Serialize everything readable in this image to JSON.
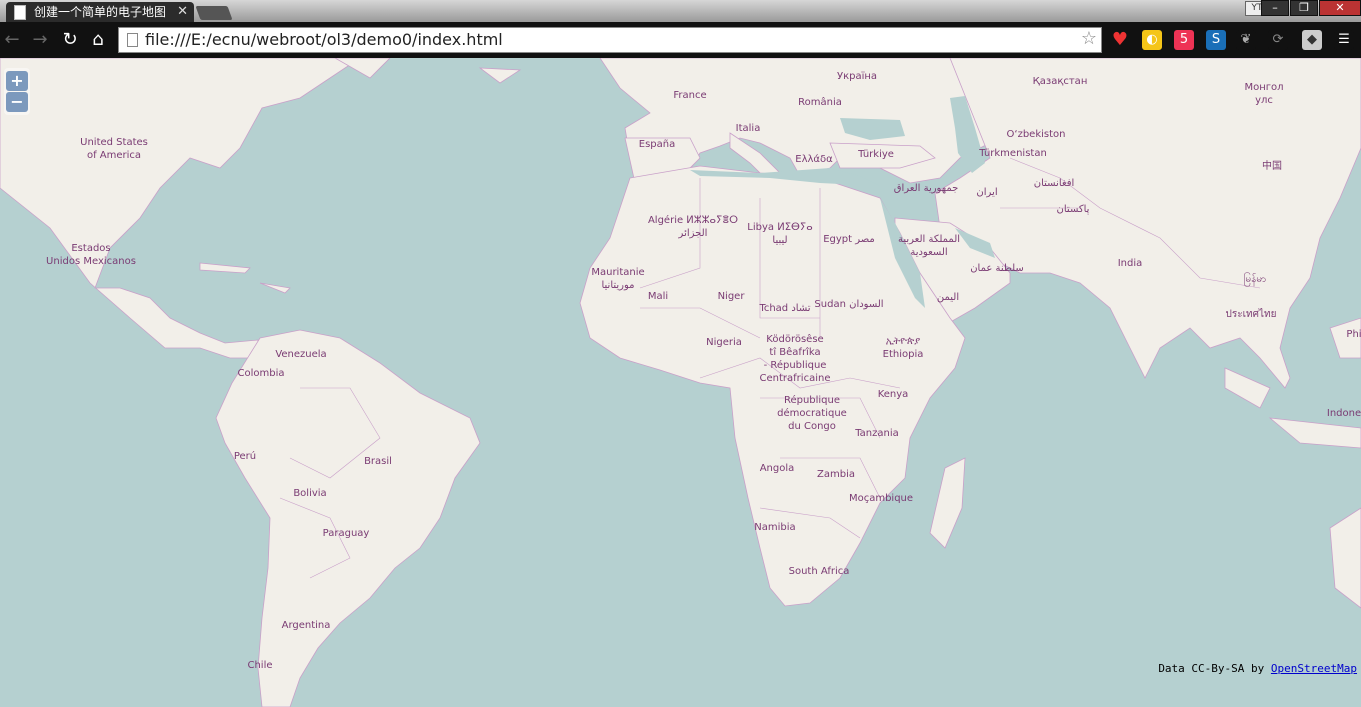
{
  "browser": {
    "tab_title": "创建一个简单的电子地图",
    "tab_close": "✕",
    "url": "file:///E:/ecnu/webroot/ol3/demo0/index.html",
    "yt_badge": "YT",
    "window_buttons": [
      "–",
      "❐",
      "✕"
    ]
  },
  "map": {
    "zoom_in": "+",
    "zoom_out": "−",
    "attribution_prefix": "Data CC-By-SA by",
    "attribution_link": "OpenStreetMap",
    "labels": [
      {
        "id": "ukraine",
        "text": "Україна"
      },
      {
        "id": "kazakhstan",
        "text": "Қазақстан"
      },
      {
        "id": "mongolia",
        "text": "Монгол\nулс"
      },
      {
        "id": "france",
        "text": "France"
      },
      {
        "id": "romania",
        "text": "România"
      },
      {
        "id": "italia",
        "text": "Italia"
      },
      {
        "id": "espana",
        "text": "España"
      },
      {
        "id": "greece",
        "text": "Ελλάδα"
      },
      {
        "id": "turkiye",
        "text": "Türkiye"
      },
      {
        "id": "uzbekistan",
        "text": "O‘zbekiston"
      },
      {
        "id": "turkmenistan",
        "text": "Türkmenistan"
      },
      {
        "id": "china",
        "text": "中国"
      },
      {
        "id": "usa",
        "text": "United States\nof America"
      },
      {
        "id": "iraq",
        "text": "جمهورية العراق"
      },
      {
        "id": "iran",
        "text": "ایران"
      },
      {
        "id": "afghanistan",
        "text": "افغانستان"
      },
      {
        "id": "pakistan",
        "text": "پاکستان"
      },
      {
        "id": "algeria",
        "text": "Algérie ⵍⵣⵣⴰⵢⴻⵔ\nالجزائر"
      },
      {
        "id": "libya",
        "text": "Libya ⵍⵉⴱⵢⴰ\nليبيا"
      },
      {
        "id": "egypt",
        "text": "Egypt مصر"
      },
      {
        "id": "saudi",
        "text": "المملكة العربية\nالسعودية"
      },
      {
        "id": "oman",
        "text": "سلطنة عمان"
      },
      {
        "id": "india",
        "text": "India"
      },
      {
        "id": "myanmar",
        "text": "မြန်မာ"
      },
      {
        "id": "mexico",
        "text": "Estados\nUnidos Mexicanos"
      },
      {
        "id": "mauritania",
        "text": "Mauritanie\nموريتانيا"
      },
      {
        "id": "mali",
        "text": "Mali"
      },
      {
        "id": "niger",
        "text": "Niger"
      },
      {
        "id": "chad",
        "text": "Tchad تشاد"
      },
      {
        "id": "sudan",
        "text": "Sudan السودان"
      },
      {
        "id": "yemen",
        "text": "اليمن"
      },
      {
        "id": "thailand",
        "text": "ประเทศไทย"
      },
      {
        "id": "philippines",
        "text": "Phi"
      },
      {
        "id": "venezuela",
        "text": "Venezuela"
      },
      {
        "id": "colombia",
        "text": "Colombia"
      },
      {
        "id": "nigeria",
        "text": "Nigeria"
      },
      {
        "id": "car",
        "text": "Ködörösêse\ntî Bêafrîka\n- République\nCentrafricaine"
      },
      {
        "id": "ethiopia",
        "text": "ኢትዮጵያ\nEthiopia"
      },
      {
        "id": "indonesia",
        "text": "Indone"
      },
      {
        "id": "kenya",
        "text": "Kenya"
      },
      {
        "id": "drc",
        "text": "République\ndémocratique\ndu Congo"
      },
      {
        "id": "tanzania",
        "text": "Tanzania"
      },
      {
        "id": "peru",
        "text": "Perú"
      },
      {
        "id": "brasil",
        "text": "Brasil"
      },
      {
        "id": "angola",
        "text": "Angola"
      },
      {
        "id": "zambia",
        "text": "Zambia"
      },
      {
        "id": "bolivia",
        "text": "Bolivia"
      },
      {
        "id": "mocambique",
        "text": "Moçambique"
      },
      {
        "id": "namibia",
        "text": "Namibia"
      },
      {
        "id": "paraguay",
        "text": "Paraguay"
      },
      {
        "id": "southafrica",
        "text": "South Africa"
      },
      {
        "id": "argentina",
        "text": "Argentina"
      },
      {
        "id": "chile",
        "text": "Chile"
      }
    ]
  },
  "colors": {
    "land": "#f2efe9",
    "water": "#b5d0d0",
    "border": "#c9a0c9",
    "label": "#7a3b73"
  }
}
